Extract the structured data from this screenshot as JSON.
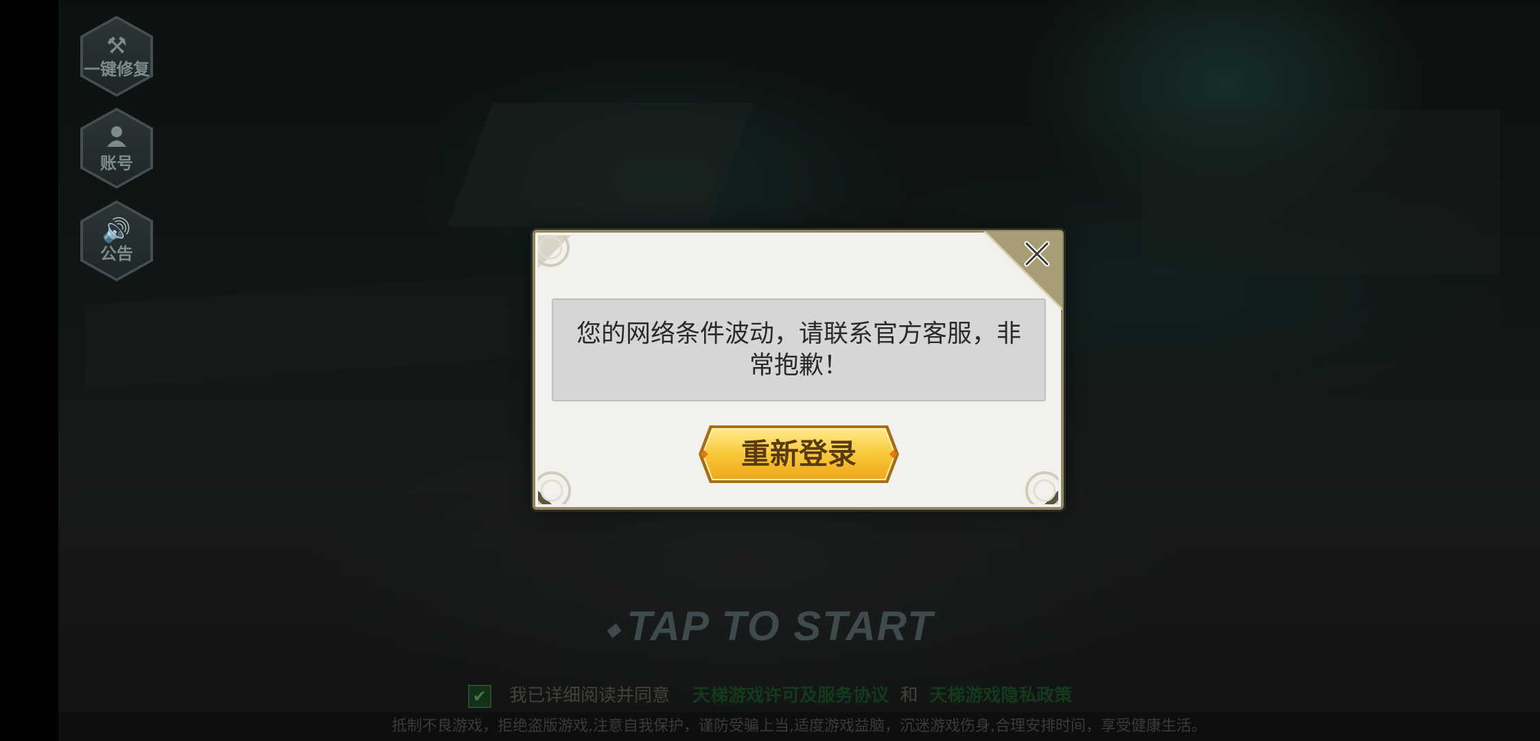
{
  "sidebar": {
    "items": [
      {
        "label": "一键修复",
        "icon": "repair-tools-icon"
      },
      {
        "label": "账号",
        "icon": "account-person-icon"
      },
      {
        "label": "公告",
        "icon": "speaker-announcement-icon"
      }
    ]
  },
  "start": {
    "label": "TAP TO START"
  },
  "agreement": {
    "prefix": "我已详细阅读并同意",
    "link1": "天梯游戏许可及服务协议",
    "and": "和",
    "link2": "天梯游戏隐私政策",
    "checked": true
  },
  "notice": "抵制不良游戏，拒绝盗版游戏,注意自我保护，谨防受骗上当,适度游戏益脑，沉迷游戏伤身,合理安排时间，享受健康生活。",
  "dialog": {
    "message": "您的网络条件波动，请联系官方客服，非常抱歉！",
    "button_label": "重新登录",
    "close_icon": "close-x-icon"
  },
  "colors": {
    "dialog_bg": "#f3f1ee",
    "dialog_border": "#8f8760",
    "button_gold": "#f5c232",
    "message_bg": "#d6d6d6"
  }
}
